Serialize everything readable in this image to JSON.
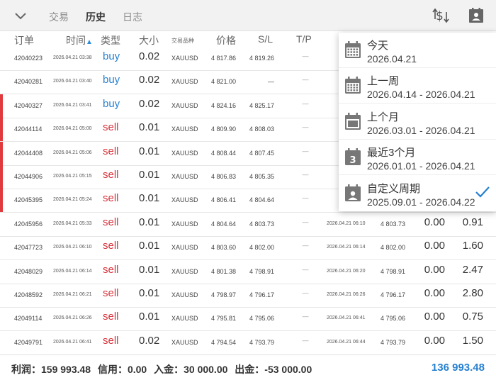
{
  "tabs": [
    {
      "label": "交易",
      "active": false
    },
    {
      "label": "历史",
      "active": true
    },
    {
      "label": "日志",
      "active": false
    }
  ],
  "columns": {
    "order": "订单",
    "time": "时间",
    "type": "类型",
    "size": "大小",
    "symbol": "交易品种",
    "price": "价格",
    "sl": "S/L",
    "tp": "T/P"
  },
  "rows": [
    {
      "order": "42040223",
      "time": "2026.04.21 03:38",
      "type": "buy",
      "size": "0.02",
      "symbol": "XAUUSD",
      "price": "4 817.86",
      "sl": "4 819.26",
      "tp": "—",
      "close_time": "",
      "close_price": "",
      "commission": "",
      "profit": "",
      "loss": false
    },
    {
      "order": "42040281",
      "time": "2026.04.21 03:40",
      "type": "buy",
      "size": "0.02",
      "symbol": "XAUUSD",
      "price": "4 821.00",
      "sl": "—",
      "tp": "—",
      "close_time": "",
      "close_price": "",
      "commission": "",
      "profit": "",
      "loss": false
    },
    {
      "order": "42040327",
      "time": "2026.04.21 03:41",
      "type": "buy",
      "size": "0.02",
      "symbol": "XAUUSD",
      "price": "4 824.16",
      "sl": "4 825.17",
      "tp": "—",
      "close_time": "",
      "close_price": "",
      "commission": "",
      "profit": "",
      "loss": true
    },
    {
      "order": "42044114",
      "time": "2026.04.21 05:00",
      "type": "sell",
      "size": "0.01",
      "symbol": "XAUUSD",
      "price": "4 809.90",
      "sl": "4 808.03",
      "tp": "—",
      "close_time": "",
      "close_price": "",
      "commission": "",
      "profit": "",
      "loss": true
    },
    {
      "order": "42044408",
      "time": "2026.04.21 05:06",
      "type": "sell",
      "size": "0.01",
      "symbol": "XAUUSD",
      "price": "4 808.44",
      "sl": "4 807.45",
      "tp": "—",
      "close_time": "",
      "close_price": "",
      "commission": "",
      "profit": "",
      "loss": true
    },
    {
      "order": "42044906",
      "time": "2026.04.21 05:15",
      "type": "sell",
      "size": "0.01",
      "symbol": "XAUUSD",
      "price": "4 806.83",
      "sl": "4 805.35",
      "tp": "—",
      "close_time": "",
      "close_price": "",
      "commission": "",
      "profit": "",
      "loss": true
    },
    {
      "order": "42045395",
      "time": "2026.04.21 05:24",
      "type": "sell",
      "size": "0.01",
      "symbol": "XAUUSD",
      "price": "4 806.41",
      "sl": "4 804.64",
      "tp": "—",
      "close_time": "",
      "close_price": "",
      "commission": "",
      "profit": "",
      "loss": true
    },
    {
      "order": "42045956",
      "time": "2026.04.21 05:33",
      "type": "sell",
      "size": "0.01",
      "symbol": "XAUUSD",
      "price": "4 804.64",
      "sl": "4 803.73",
      "tp": "—",
      "close_time": "2026.04.21 06:10",
      "close_price": "4 803.73",
      "commission": "0.00",
      "profit": "0.91",
      "loss": false
    },
    {
      "order": "42047723",
      "time": "2026.04.21 06:10",
      "type": "sell",
      "size": "0.01",
      "symbol": "XAUUSD",
      "price": "4 803.60",
      "sl": "4 802.00",
      "tp": "—",
      "close_time": "2026.04.21 06:14",
      "close_price": "4 802.00",
      "commission": "0.00",
      "profit": "1.60",
      "loss": false
    },
    {
      "order": "42048029",
      "time": "2026.04.21 06:14",
      "type": "sell",
      "size": "0.01",
      "symbol": "XAUUSD",
      "price": "4 801.38",
      "sl": "4 798.91",
      "tp": "—",
      "close_time": "2026.04.21 06:20",
      "close_price": "4 798.91",
      "commission": "0.00",
      "profit": "2.47",
      "loss": false
    },
    {
      "order": "42048592",
      "time": "2026.04.21 06:21",
      "type": "sell",
      "size": "0.01",
      "symbol": "XAUUSD",
      "price": "4 798.97",
      "sl": "4 796.17",
      "tp": "—",
      "close_time": "2026.04.21 06:26",
      "close_price": "4 796.17",
      "commission": "0.00",
      "profit": "2.80",
      "loss": false
    },
    {
      "order": "42049114",
      "time": "2026.04.21 06:26",
      "type": "sell",
      "size": "0.01",
      "symbol": "XAUUSD",
      "price": "4 795.81",
      "sl": "4 795.06",
      "tp": "—",
      "close_time": "2026.04.21 06:41",
      "close_price": "4 795.06",
      "commission": "0.00",
      "profit": "0.75",
      "loss": false
    },
    {
      "order": "42049791",
      "time": "2026.04.21 06:41",
      "type": "sell",
      "size": "0.02",
      "symbol": "XAUUSD",
      "price": "4 794.54",
      "sl": "4 793.79",
      "tp": "—",
      "close_time": "2026.04.21 06:44",
      "close_price": "4 793.79",
      "commission": "0.00",
      "profit": "1.50",
      "loss": false
    }
  ],
  "footer": {
    "profit": "利润：159 993.48",
    "credit": "信用：0.00",
    "deposit": "入金：30 000.00",
    "withdrawal": "出金：-53 000.00",
    "balance": "136 993.48"
  },
  "period_menu": [
    {
      "title": "今天",
      "range": "2026.04.21",
      "icon": "calendar-today-icon",
      "selected": false
    },
    {
      "title": "上一周",
      "range": "2026.04.14 - 2026.04.21",
      "icon": "calendar-week-icon",
      "selected": false
    },
    {
      "title": "上个月",
      "range": "2026.03.01 - 2026.04.21",
      "icon": "calendar-month-icon",
      "selected": false
    },
    {
      "title": "最近3个月",
      "range": "2026.01.01 - 2026.04.21",
      "icon": "calendar-3-icon",
      "icon_text": "3",
      "selected": false
    },
    {
      "title": "自定义周期",
      "range": "2025.09.01 - 2026.04.22",
      "icon": "calendar-custom-icon",
      "selected": true
    }
  ],
  "colors": {
    "buy": "#2680d0",
    "sell": "#d7323a",
    "loss_bar": "#e0393e",
    "balance": "#2680d0",
    "check": "#2680d0"
  }
}
